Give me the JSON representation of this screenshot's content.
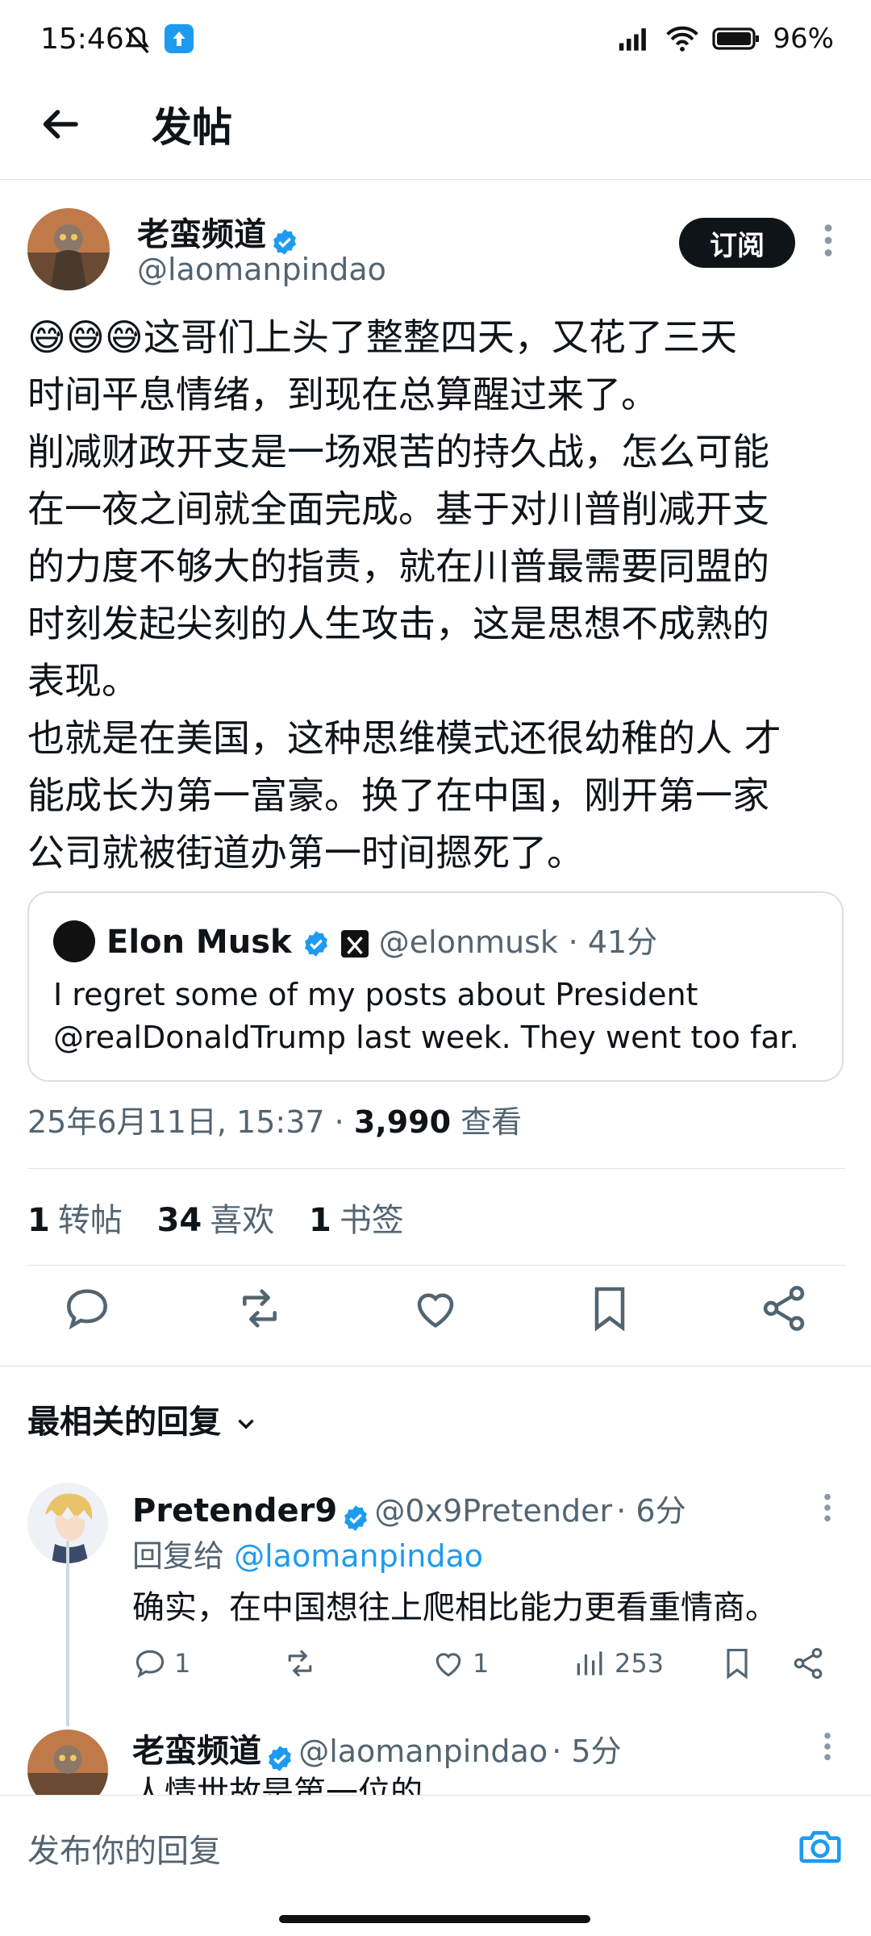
{
  "status_bar": {
    "time": "15:46",
    "battery": "96%"
  },
  "header": {
    "title": "发帖"
  },
  "post": {
    "author_name": "老蛮频道",
    "author_handle": "@laomanpindao",
    "subscribe_label": "订阅",
    "text": "😅😅😅这哥们上头了整整四天，又花了三天\n时间平息情绪，到现在总算醒过来了。\n削减财政开支是一场艰苦的持久战，怎么可能\n在一夜之间就全面完成。基于对川普削减开支\n的力度不够大的指责，就在川普最需要同盟的\n时刻发起尖刻的人生攻击，这是思想不成熟的\n表现。\n也就是在美国，这种思维模式还很幼稚的人 才\n能成长为第一富豪。换了在中国，刚开第一家\n公司就被街道办第一时间摁死了。",
    "quote": {
      "name": "Elon Musk",
      "handle": "@elonmusk",
      "time": "· 41分",
      "text": "I regret some of my posts about President\n@realDonaldTrump last week. They went too far."
    },
    "timestamp": "25年6月11日, 15:37 ·",
    "views_count": "3,990",
    "views_label": "查看",
    "stats": [
      {
        "count": "1",
        "label": "转帖"
      },
      {
        "count": "34",
        "label": "喜欢"
      },
      {
        "count": "1",
        "label": "书签"
      }
    ]
  },
  "replies_header": {
    "sort_label": "最相关的回复"
  },
  "replies": [
    {
      "name": "Pretender9",
      "handle": "@0x9Pretender",
      "time": "· 6分",
      "reply_to_label": "回复给",
      "reply_to_handle": "@laomanpindao",
      "text": "确实，在中国想往上爬相比能力更看重情商。",
      "reply_count": "1",
      "like_count": "1",
      "view_count": "253"
    },
    {
      "name": "老蛮频道",
      "handle": "@laomanpindao",
      "time": "· 5分",
      "text": "人情世故是第一位的"
    }
  ],
  "compose": {
    "placeholder": "发布你的回复"
  },
  "colors": {
    "accent": "#1d9bf0",
    "text": "#0f1419",
    "muted": "#536471"
  },
  "icons": [
    "back-arrow-icon",
    "verified-badge-icon",
    "more-icon",
    "x-logo-icon",
    "reply-icon",
    "repost-icon",
    "like-icon",
    "bookmark-icon",
    "share-icon",
    "views-icon",
    "chevron-down-icon",
    "camera-icon"
  ]
}
